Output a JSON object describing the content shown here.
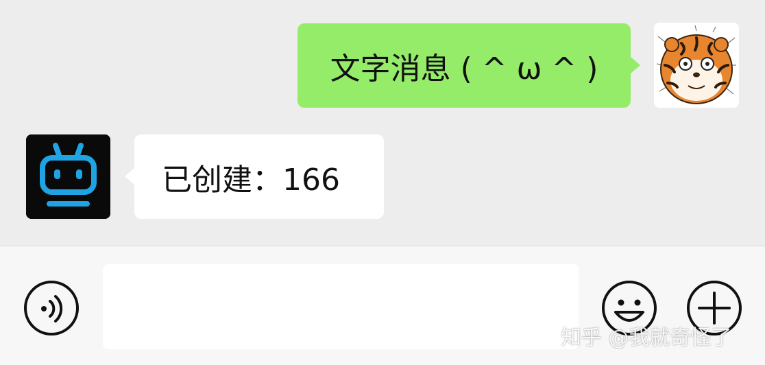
{
  "messages": {
    "sent_text": "文字消息 ( ^ ω ^ )",
    "received_text": "已创建：166"
  },
  "input": {
    "value": "",
    "placeholder": ""
  },
  "icons": {
    "voice": "voice-icon",
    "emoji": "emoji-icon",
    "plus": "plus-icon",
    "user_avatar": "tiger-avatar",
    "bot_avatar": "robot-avatar"
  },
  "colors": {
    "sent_bubble": "#95ec69",
    "received_bubble": "#ffffff",
    "chat_background": "#ededed",
    "bot_icon": "#1fa3e3"
  },
  "watermark": "知乎 @我就奇怪了"
}
